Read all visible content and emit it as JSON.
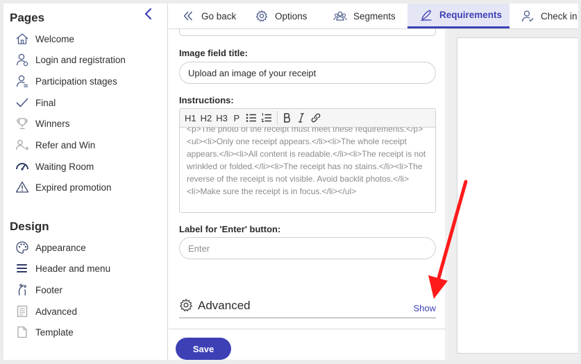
{
  "sidebar": {
    "pages_title": "Pages",
    "pages": [
      {
        "label": "Welcome",
        "icon": "home-icon"
      },
      {
        "label": "Login and registration",
        "icon": "user-icon"
      },
      {
        "label": "Participation stages",
        "icon": "user-icon"
      },
      {
        "label": "Final",
        "icon": "check-icon"
      },
      {
        "label": "Winners",
        "icon": "trophy-icon"
      },
      {
        "label": "Refer and Win",
        "icon": "refer-icon"
      },
      {
        "label": "Waiting Room",
        "icon": "gauge-icon"
      },
      {
        "label": "Expired promotion",
        "icon": "warning-icon"
      }
    ],
    "design_title": "Design",
    "design": [
      {
        "label": "Appearance",
        "icon": "palette-icon"
      },
      {
        "label": "Header and menu",
        "icon": "menu-icon"
      },
      {
        "label": "Footer",
        "icon": "footer-icon"
      },
      {
        "label": "Advanced",
        "icon": "advanced-icon"
      },
      {
        "label": "Template",
        "icon": "template-icon"
      }
    ]
  },
  "tabs": [
    {
      "label": "Go back",
      "icon": "chevron-double-left-icon"
    },
    {
      "label": "Options",
      "icon": "gear-icon"
    },
    {
      "label": "Segments",
      "icon": "users-icon"
    },
    {
      "label": "Requirements",
      "icon": "requirements-icon",
      "active": true
    },
    {
      "label": "Check in",
      "icon": "check-in-icon"
    }
  ],
  "form": {
    "image_field_title_label": "Image field title:",
    "image_field_title_value": "Upload an image of your receipt",
    "instructions_label": "Instructions:",
    "toolbar": [
      "H1",
      "H2",
      "H3",
      "P"
    ],
    "instructions_text": "<p>The photo of the receipt must meet these requirements:</p><ul><li>Only one receipt appears.</li><li>The whole receipt appears.</li><li>All content is readable.</li><li>The receipt is not wrinkled or folded.</li><li>The receipt has no stains.</li><li>The reverse of the receipt is not visible. Avoid backlit photos.</li><li>Make sure the receipt is in focus.</li></ul>",
    "enter_label": "Label for 'Enter' button:",
    "enter_placeholder": "Enter",
    "advanced_title": "Advanced",
    "advanced_show": "Show",
    "save_label": "Save"
  },
  "colors": {
    "accent": "#3d40b5",
    "active_tab_bg": "#e5e6f5",
    "annotation_arrow": "#ff1a1a"
  }
}
